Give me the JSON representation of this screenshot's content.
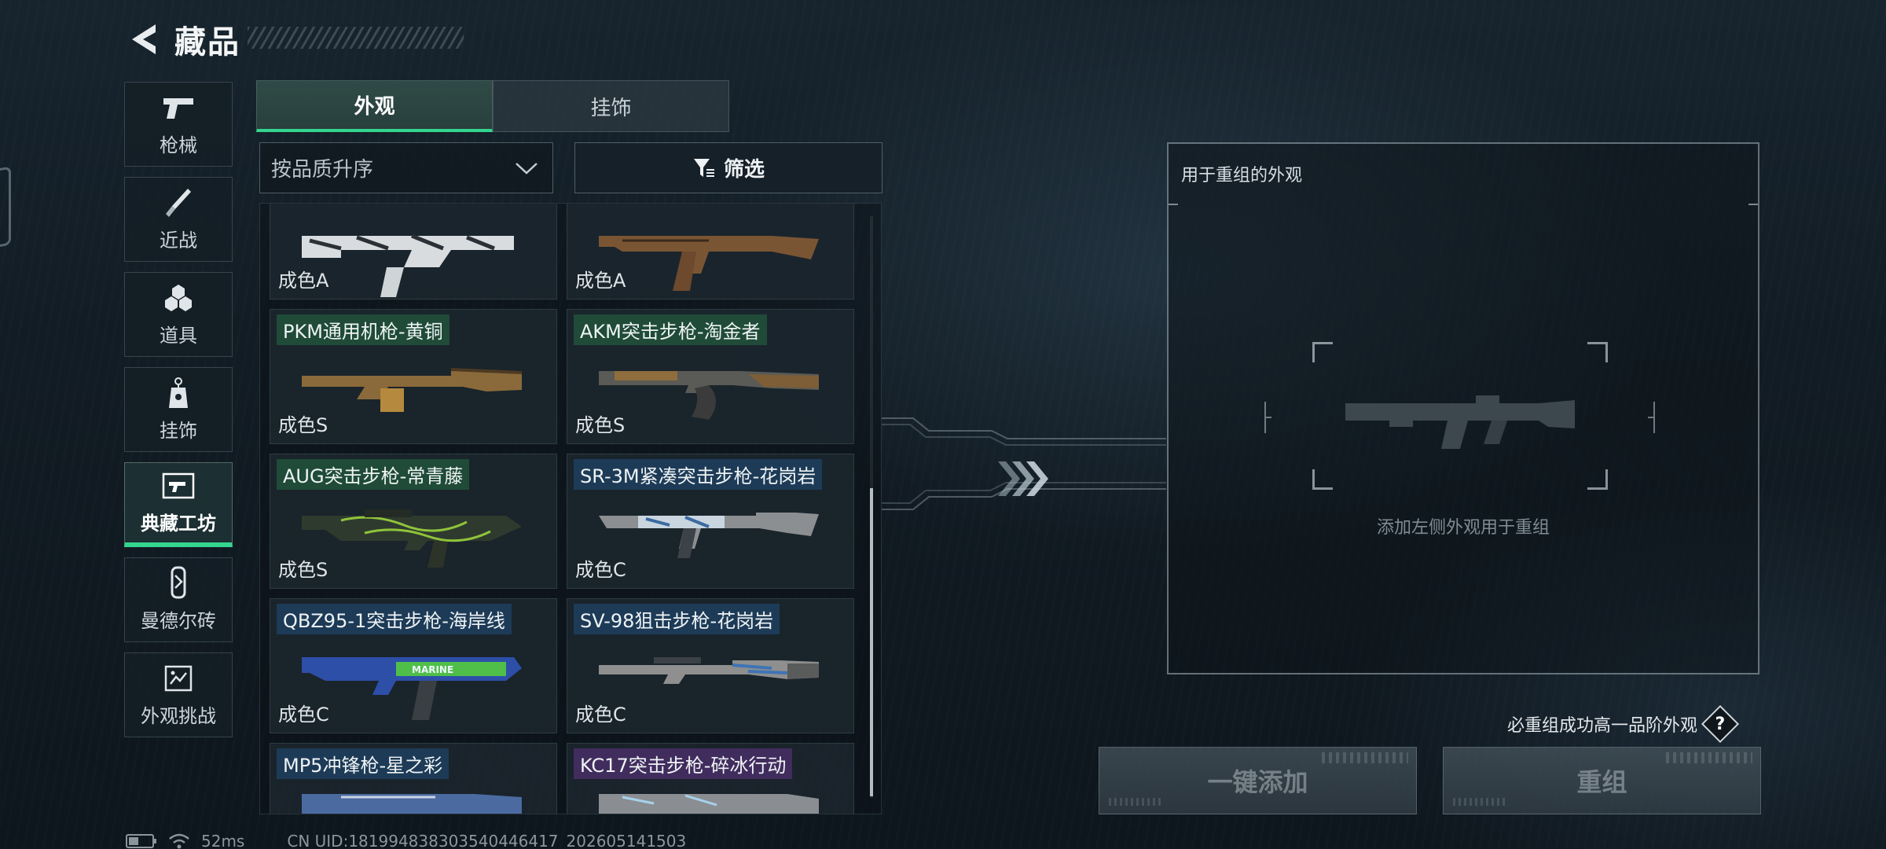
{
  "header": {
    "title": "藏品"
  },
  "categories": [
    {
      "label": "枪械",
      "icon": "pistol-icon"
    },
    {
      "label": "近战",
      "icon": "knife-icon"
    },
    {
      "label": "道具",
      "icon": "grenades-icon"
    },
    {
      "label": "挂饰",
      "icon": "charm-icon"
    },
    {
      "label": "典藏工坊",
      "icon": "workshop-icon",
      "active": true
    },
    {
      "label": "曼德尔砖",
      "icon": "brick-icon"
    },
    {
      "label": "外观挑战",
      "icon": "challenge-icon"
    }
  ],
  "tabs": [
    {
      "label": "外观",
      "active": true
    },
    {
      "label": "挂饰",
      "active": false
    }
  ],
  "sort": {
    "label": "按品质升序"
  },
  "filter": {
    "label": "筛选"
  },
  "items": [
    {
      "name": "",
      "grade": "成色A",
      "rarity": "none"
    },
    {
      "name": "",
      "grade": "成色A",
      "rarity": "none"
    },
    {
      "name": "PKM通用机枪-黄铜",
      "grade": "成色S",
      "rarity": "green"
    },
    {
      "name": "AKM突击步枪-淘金者",
      "grade": "成色S",
      "rarity": "green"
    },
    {
      "name": "AUG突击步枪-常青藤",
      "grade": "成色S",
      "rarity": "green"
    },
    {
      "name": "SR-3M紧凑突击步枪-花岗岩",
      "grade": "成色C",
      "rarity": "blue"
    },
    {
      "name": "QBZ95-1突击步枪-海岸线",
      "grade": "成色C",
      "rarity": "blue"
    },
    {
      "name": "SV-98狙击步枪-花岗岩",
      "grade": "成色C",
      "rarity": "blue"
    },
    {
      "name": "MP5冲锋枪-星之彩",
      "grade": "",
      "rarity": "blue"
    },
    {
      "name": "KC17突击步枪-碎冰行动",
      "grade": "",
      "rarity": "purple"
    }
  ],
  "recombine": {
    "title": "用于重组的外观",
    "hint": "添加左侧外观用于重组",
    "guarantee": "必重组成功高一品阶外观",
    "help": "?",
    "add_all_label": "一键添加",
    "recombine_label": "重组"
  },
  "status": {
    "ping": "52ms",
    "uid": "CN UID:181994838303540446417_202605141503"
  },
  "colors": {
    "accent": "#34d58f",
    "green_tag": "#20503a",
    "blue_tag": "#1e3e5c",
    "purple_tag": "#462e64"
  }
}
